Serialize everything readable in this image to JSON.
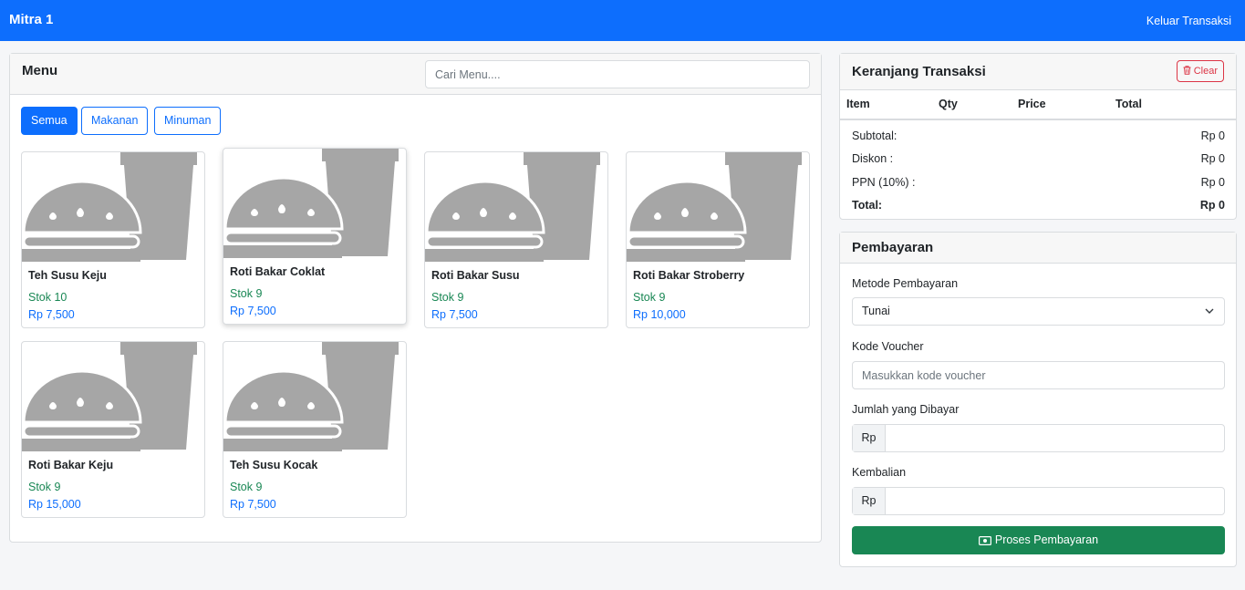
{
  "navbar": {
    "brand": "Mitra 1",
    "exit_link": "Keluar Transaksi"
  },
  "menu": {
    "title": "Menu",
    "search_placeholder": "Cari Menu....",
    "filters": [
      "Semua",
      "Makanan",
      "Minuman"
    ],
    "active_filter": "Semua",
    "items": [
      {
        "name": "Teh Susu Keju",
        "stock": "Stok 10",
        "price": "Rp 7,500",
        "icon": "burger-drink-icon"
      },
      {
        "name": "Roti Bakar Coklat",
        "stock": "Stok 9",
        "price": "Rp 7,500",
        "icon": "burger-drink-icon"
      },
      {
        "name": "Roti Bakar Susu",
        "stock": "Stok 9",
        "price": "Rp 7,500",
        "icon": "burger-drink-icon"
      },
      {
        "name": "Roti Bakar Stroberry",
        "stock": "Stok 9",
        "price": "Rp 10,000",
        "icon": "burger-drink-icon"
      },
      {
        "name": "Roti Bakar Keju",
        "stock": "Stok 9",
        "price": "Rp 15,000",
        "icon": "burger-drink-icon"
      },
      {
        "name": "Teh Susu Kocak",
        "stock": "Stok 9",
        "price": "Rp 7,500",
        "icon": "burger-drink-icon"
      }
    ]
  },
  "cart": {
    "title": "Keranjang Transaksi",
    "clear_label": "Clear",
    "columns": [
      "Item",
      "Qty",
      "Price",
      "Total"
    ],
    "subtotal_label": "Subtotal:",
    "subtotal_value": "Rp 0",
    "discount_label": "Diskon :",
    "discount_value": "Rp 0",
    "tax_label": "PPN (10%) :",
    "tax_value": "Rp 0",
    "total_label": "Total:",
    "total_value": "Rp 0"
  },
  "payment": {
    "title": "Pembayaran",
    "method_label": "Metode Pembayaran",
    "method_value": "Tunai",
    "voucher_label": "Kode Voucher",
    "voucher_placeholder": "Masukkan kode voucher",
    "paid_label": "Jumlah yang Dibayar",
    "paid_prefix": "Rp",
    "change_label": "Kembalian",
    "change_prefix": "Rp",
    "process_label": "Proses Pembayaran"
  },
  "colors": {
    "primary": "#0d6efd",
    "success": "#198754",
    "danger": "#dc3545"
  }
}
